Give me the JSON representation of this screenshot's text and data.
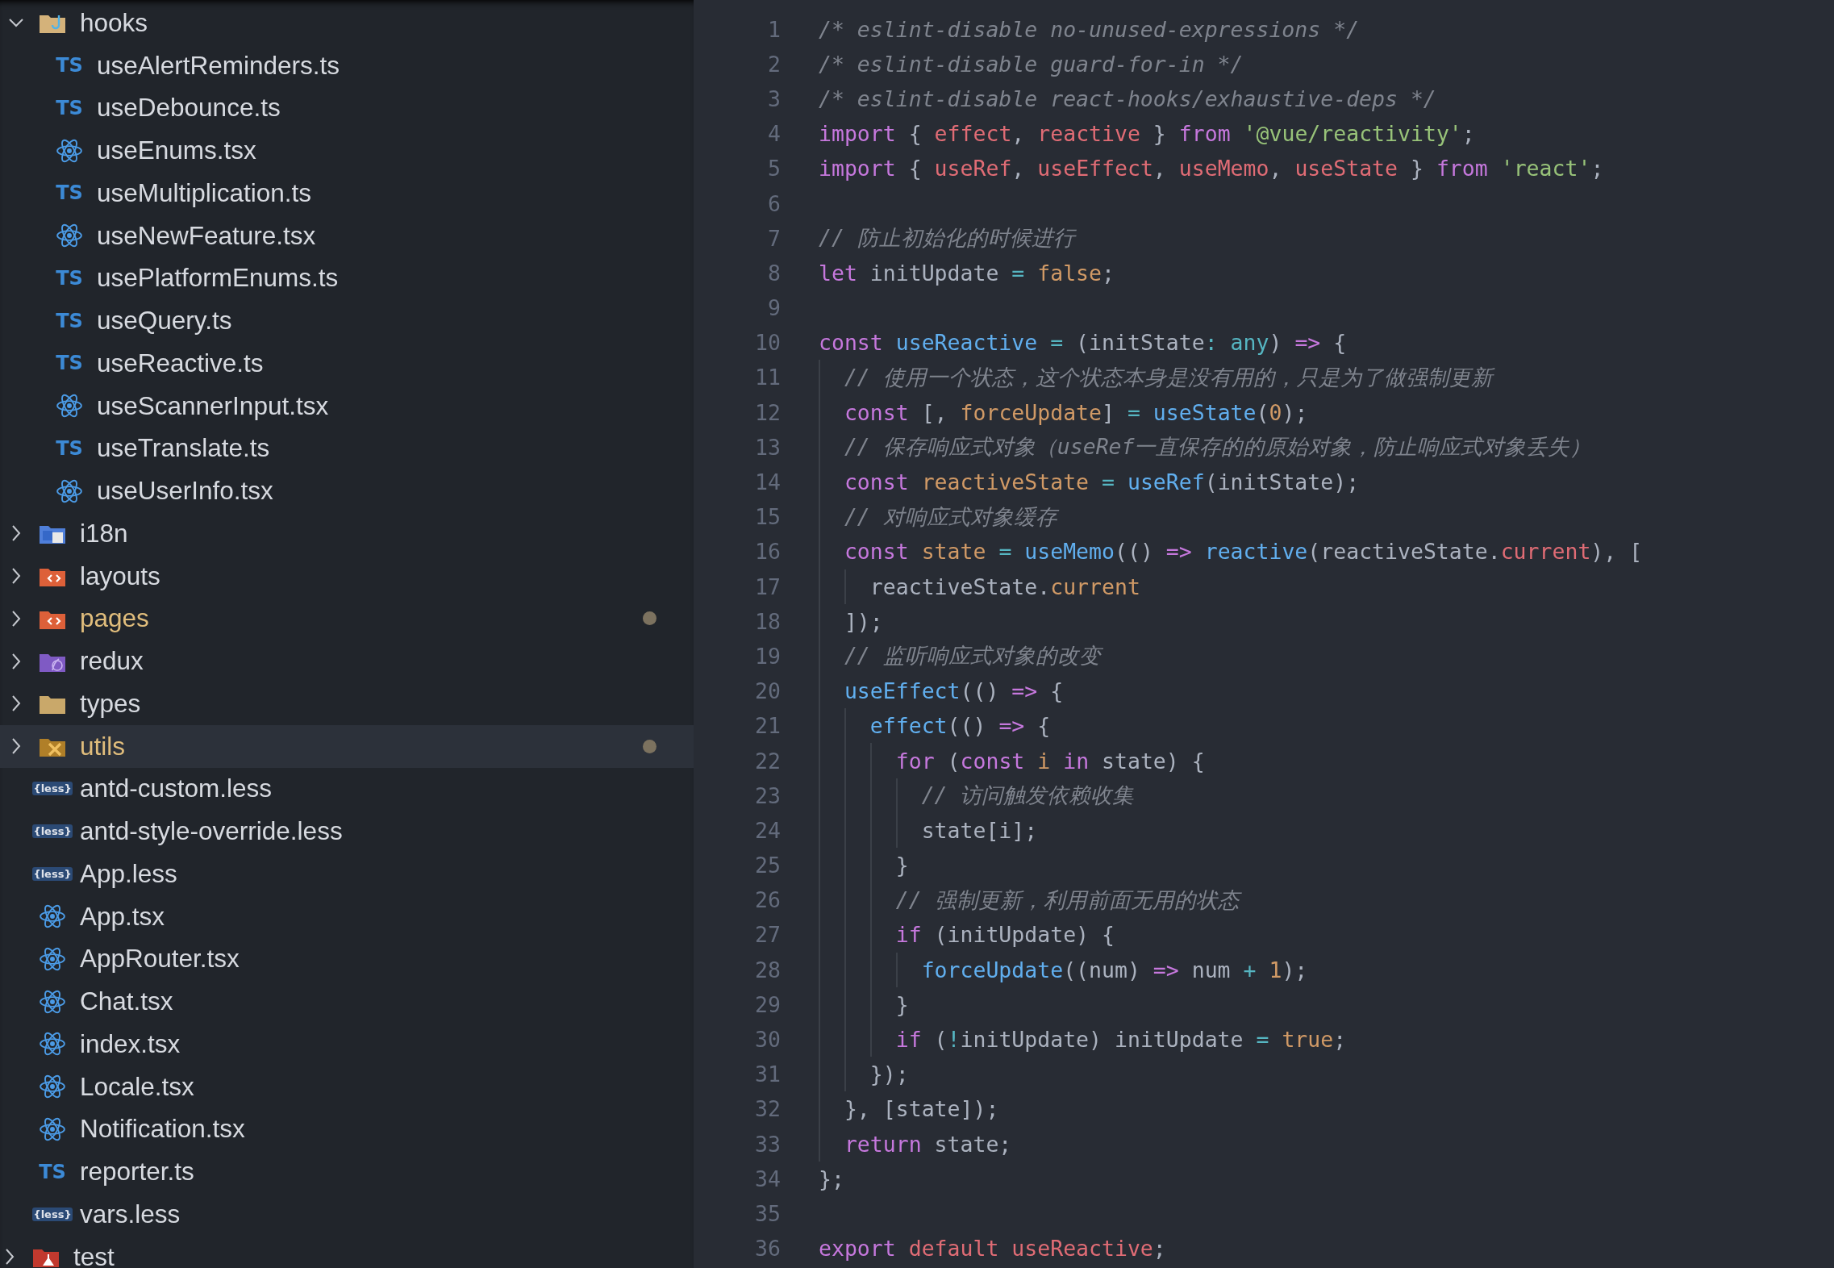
{
  "explorer": {
    "items": [
      {
        "name": "hooks",
        "kind": "hooksfolder",
        "expanded": true,
        "selected": false,
        "modified": false,
        "children": [
          {
            "name": "useAlertReminders.ts",
            "kind": "ts",
            "icon_text": "TS",
            "selected": false,
            "modified": false
          },
          {
            "name": "useDebounce.ts",
            "kind": "ts",
            "icon_text": "TS",
            "selected": false,
            "modified": false
          },
          {
            "name": "useEnums.tsx",
            "kind": "tsx",
            "selected": false,
            "modified": false
          },
          {
            "name": "useMultiplication.ts",
            "kind": "ts",
            "icon_text": "TS",
            "selected": false,
            "modified": false
          },
          {
            "name": "useNewFeature.tsx",
            "kind": "tsx",
            "selected": false,
            "modified": false
          },
          {
            "name": "usePlatformEnums.ts",
            "kind": "ts",
            "icon_text": "TS",
            "selected": false,
            "modified": false
          },
          {
            "name": "useQuery.ts",
            "kind": "ts",
            "icon_text": "TS",
            "selected": false,
            "modified": false
          },
          {
            "name": "useReactive.ts",
            "kind": "ts",
            "icon_text": "TS",
            "selected": false,
            "modified": false
          },
          {
            "name": "useScannerInput.tsx",
            "kind": "tsx",
            "selected": false,
            "modified": false
          },
          {
            "name": "useTranslate.ts",
            "kind": "ts",
            "icon_text": "TS",
            "selected": false,
            "modified": false
          },
          {
            "name": "useUserInfo.tsx",
            "kind": "tsx",
            "selected": false,
            "modified": false
          }
        ]
      },
      {
        "name": "i18n",
        "kind": "i18nfolder",
        "expanded": false,
        "selected": false,
        "modified": false
      },
      {
        "name": "layouts",
        "kind": "codefolder",
        "expanded": false,
        "selected": false,
        "modified": false
      },
      {
        "name": "pages",
        "kind": "codefolder",
        "expanded": false,
        "selected": false,
        "modified": true
      },
      {
        "name": "redux",
        "kind": "reduxfolder",
        "expanded": false,
        "selected": false,
        "modified": false
      },
      {
        "name": "types",
        "kind": "folder",
        "expanded": false,
        "selected": false,
        "modified": false
      },
      {
        "name": "utils",
        "kind": "utilsfolder",
        "expanded": false,
        "selected": true,
        "modified": true
      },
      {
        "name": "antd-custom.less",
        "kind": "less",
        "icon_text": "{less}",
        "selected": false,
        "modified": false
      },
      {
        "name": "antd-style-override.less",
        "kind": "less",
        "icon_text": "{less}",
        "selected": false,
        "modified": false
      },
      {
        "name": "App.less",
        "kind": "less",
        "icon_text": "{less}",
        "selected": false,
        "modified": false
      },
      {
        "name": "App.tsx",
        "kind": "tsx",
        "selected": false,
        "modified": false
      },
      {
        "name": "AppRouter.tsx",
        "kind": "tsx",
        "selected": false,
        "modified": false
      },
      {
        "name": "Chat.tsx",
        "kind": "tsx",
        "selected": false,
        "modified": false
      },
      {
        "name": "index.tsx",
        "kind": "tsx",
        "selected": false,
        "modified": false
      },
      {
        "name": "Locale.tsx",
        "kind": "tsx",
        "selected": false,
        "modified": false
      },
      {
        "name": "Notification.tsx",
        "kind": "tsx",
        "selected": false,
        "modified": false
      },
      {
        "name": "reporter.ts",
        "kind": "ts",
        "icon_text": "TS",
        "selected": false,
        "modified": false
      },
      {
        "name": "vars.less",
        "kind": "less",
        "icon_text": "{less}",
        "selected": false,
        "modified": false
      }
    ],
    "parent_items": [
      {
        "name": "test",
        "kind": "testfolder",
        "expanded": false,
        "selected": false,
        "modified": false
      }
    ]
  },
  "editor": {
    "lines": [
      {
        "number": "1",
        "tokens": [
          {
            "text": "/* eslint-disable no-unused-expressions */",
            "kind": "comment"
          }
        ]
      },
      {
        "number": "2",
        "tokens": [
          {
            "text": "/* eslint-disable guard-for-in */",
            "kind": "comment"
          }
        ]
      },
      {
        "number": "3",
        "tokens": [
          {
            "text": "/* eslint-disable react-hooks/exhaustive-deps */",
            "kind": "comment"
          }
        ]
      },
      {
        "number": "4",
        "tokens": [
          {
            "text": "import",
            "kind": "keyword"
          },
          {
            "text": " { ",
            "kind": "plain"
          },
          {
            "text": "effect",
            "kind": "variable"
          },
          {
            "text": ", ",
            "kind": "plain"
          },
          {
            "text": "reactive",
            "kind": "variable"
          },
          {
            "text": " } ",
            "kind": "plain"
          },
          {
            "text": "from",
            "kind": "keyword"
          },
          {
            "text": " '@vue/reactivity'",
            "kind": "string"
          },
          {
            "text": ";",
            "kind": "plain"
          }
        ]
      },
      {
        "number": "5",
        "tokens": [
          {
            "text": "import",
            "kind": "keyword"
          },
          {
            "text": " { ",
            "kind": "plain"
          },
          {
            "text": "useRef",
            "kind": "variable"
          },
          {
            "text": ", ",
            "kind": "plain"
          },
          {
            "text": "useEffect",
            "kind": "variable"
          },
          {
            "text": ", ",
            "kind": "plain"
          },
          {
            "text": "useMemo",
            "kind": "variable"
          },
          {
            "text": ", ",
            "kind": "plain"
          },
          {
            "text": "useState",
            "kind": "variable"
          },
          {
            "text": " } ",
            "kind": "plain"
          },
          {
            "text": "from",
            "kind": "keyword"
          },
          {
            "text": " 'react'",
            "kind": "string"
          },
          {
            "text": ";",
            "kind": "plain"
          }
        ]
      },
      {
        "number": "6"
      },
      {
        "number": "7",
        "tokens": [
          {
            "text": "// 防止初始化的时候进行",
            "kind": "comment"
          }
        ]
      },
      {
        "number": "8",
        "tokens": [
          {
            "text": "let",
            "kind": "keyword"
          },
          {
            "text": " initUpdate ",
            "kind": "plain"
          },
          {
            "text": "=",
            "kind": "operator"
          },
          {
            "text": " false",
            "kind": "constant"
          },
          {
            "text": ";",
            "kind": "plain"
          }
        ]
      },
      {
        "number": "9"
      },
      {
        "number": "10",
        "tokens": [
          {
            "text": "const",
            "kind": "keyword"
          },
          {
            "text": " useReactive",
            "kind": "function"
          },
          {
            "text": " =",
            "kind": "operator"
          },
          {
            "text": " (initState",
            "kind": "plain"
          },
          {
            "text": ":",
            "kind": "operator"
          },
          {
            "text": " any",
            "kind": "operator"
          },
          {
            "text": ") ",
            "kind": "plain"
          },
          {
            "text": "=>",
            "kind": "keyword"
          },
          {
            "text": " {",
            "kind": "plain"
          }
        ]
      },
      {
        "number": "11",
        "tokens": [
          {
            "text": "  // 使用一个状态，这个状态本身是没有用的，只是为了做强制更新",
            "kind": "comment"
          }
        ]
      },
      {
        "number": "12",
        "tokens": [
          {
            "text": "  const",
            "kind": "keyword"
          },
          {
            "text": " [, ",
            "kind": "plain"
          },
          {
            "text": "forceUpdate",
            "kind": "constant"
          },
          {
            "text": "] ",
            "kind": "plain"
          },
          {
            "text": "=",
            "kind": "operator"
          },
          {
            "text": " useState",
            "kind": "function"
          },
          {
            "text": "(",
            "kind": "plain"
          },
          {
            "text": "0",
            "kind": "constant"
          },
          {
            "text": ");",
            "kind": "plain"
          }
        ]
      },
      {
        "number": "13",
        "tokens": [
          {
            "text": "  // 保存响应式对象（useRef一直保存的的原始对象，防止响应式对象丢失）",
            "kind": "comment"
          }
        ]
      },
      {
        "number": "14",
        "tokens": [
          {
            "text": "  const",
            "kind": "keyword"
          },
          {
            "text": " reactiveState",
            "kind": "constant"
          },
          {
            "text": " =",
            "kind": "operator"
          },
          {
            "text": " useRef",
            "kind": "function"
          },
          {
            "text": "(initState);",
            "kind": "plain"
          }
        ]
      },
      {
        "number": "15",
        "tokens": [
          {
            "text": "  // 对响应式对象缓存",
            "kind": "comment"
          }
        ]
      },
      {
        "number": "16",
        "tokens": [
          {
            "text": "  const",
            "kind": "keyword"
          },
          {
            "text": " state",
            "kind": "constant"
          },
          {
            "text": " =",
            "kind": "operator"
          },
          {
            "text": " useMemo",
            "kind": "function"
          },
          {
            "text": "(() ",
            "kind": "plain"
          },
          {
            "text": "=>",
            "kind": "keyword"
          },
          {
            "text": " reactive",
            "kind": "function"
          },
          {
            "text": "(reactiveState.",
            "kind": "plain"
          },
          {
            "text": "current",
            "kind": "variable"
          },
          {
            "text": "), [",
            "kind": "plain"
          }
        ]
      },
      {
        "number": "17",
        "tokens": [
          {
            "text": "    reactiveState.",
            "kind": "plain"
          },
          {
            "text": "current",
            "kind": "constant"
          }
        ]
      },
      {
        "number": "18",
        "tokens": [
          {
            "text": "  ]);",
            "kind": "plain"
          }
        ]
      },
      {
        "number": "19",
        "tokens": [
          {
            "text": "  // 监听响应式对象的改变",
            "kind": "comment"
          }
        ]
      },
      {
        "number": "20",
        "tokens": [
          {
            "text": "  useEffect",
            "kind": "function"
          },
          {
            "text": "(() ",
            "kind": "plain"
          },
          {
            "text": "=>",
            "kind": "keyword"
          },
          {
            "text": " {",
            "kind": "plain"
          }
        ]
      },
      {
        "number": "21",
        "tokens": [
          {
            "text": "    effect",
            "kind": "function"
          },
          {
            "text": "(() ",
            "kind": "plain"
          },
          {
            "text": "=>",
            "kind": "keyword"
          },
          {
            "text": " {",
            "kind": "plain"
          }
        ]
      },
      {
        "number": "22",
        "tokens": [
          {
            "text": "      for",
            "kind": "keyword"
          },
          {
            "text": " (",
            "kind": "plain"
          },
          {
            "text": "const",
            "kind": "keyword"
          },
          {
            "text": " i",
            "kind": "constant"
          },
          {
            "text": " in",
            "kind": "keyword"
          },
          {
            "text": " state) {",
            "kind": "plain"
          }
        ]
      },
      {
        "number": "23",
        "tokens": [
          {
            "text": "        // 访问触发依赖收集",
            "kind": "comment"
          }
        ]
      },
      {
        "number": "24",
        "tokens": [
          {
            "text": "        state[i];",
            "kind": "plain"
          }
        ]
      },
      {
        "number": "25",
        "tokens": [
          {
            "text": "      }",
            "kind": "plain"
          }
        ]
      },
      {
        "number": "26",
        "tokens": [
          {
            "text": "      // 强制更新，利用前面无用的状态",
            "kind": "comment"
          }
        ]
      },
      {
        "number": "27",
        "tokens": [
          {
            "text": "      if",
            "kind": "keyword"
          },
          {
            "text": " (initUpdate) {",
            "kind": "plain"
          }
        ]
      },
      {
        "number": "28",
        "tokens": [
          {
            "text": "        forceUpdate",
            "kind": "function"
          },
          {
            "text": "((num) ",
            "kind": "plain"
          },
          {
            "text": "=>",
            "kind": "keyword"
          },
          {
            "text": " num ",
            "kind": "plain"
          },
          {
            "text": "+",
            "kind": "operator"
          },
          {
            "text": " 1",
            "kind": "constant"
          },
          {
            "text": ");",
            "kind": "plain"
          }
        ]
      },
      {
        "number": "29",
        "tokens": [
          {
            "text": "      }",
            "kind": "plain"
          }
        ]
      },
      {
        "number": "30",
        "tokens": [
          {
            "text": "      if",
            "kind": "keyword"
          },
          {
            "text": " (",
            "kind": "plain"
          },
          {
            "text": "!",
            "kind": "operator"
          },
          {
            "text": "initUpdate) initUpdate ",
            "kind": "plain"
          },
          {
            "text": "=",
            "kind": "operator"
          },
          {
            "text": " true",
            "kind": "constant"
          },
          {
            "text": ";",
            "kind": "plain"
          }
        ]
      },
      {
        "number": "31",
        "tokens": [
          {
            "text": "    });",
            "kind": "plain"
          }
        ]
      },
      {
        "number": "32",
        "tokens": [
          {
            "text": "  }, [state]);",
            "kind": "plain"
          }
        ]
      },
      {
        "number": "33",
        "tokens": [
          {
            "text": "  return",
            "kind": "keyword"
          },
          {
            "text": " state;",
            "kind": "plain"
          }
        ]
      },
      {
        "number": "34",
        "tokens": [
          {
            "text": "};",
            "kind": "plain"
          }
        ]
      },
      {
        "number": "35"
      },
      {
        "number": "36",
        "tokens": [
          {
            "text": "export",
            "kind": "keyword"
          },
          {
            "text": " default",
            "kind": "variable"
          },
          {
            "text": " useReactive",
            "kind": "variable"
          },
          {
            "text": ";",
            "kind": "plain"
          }
        ]
      }
    ]
  }
}
